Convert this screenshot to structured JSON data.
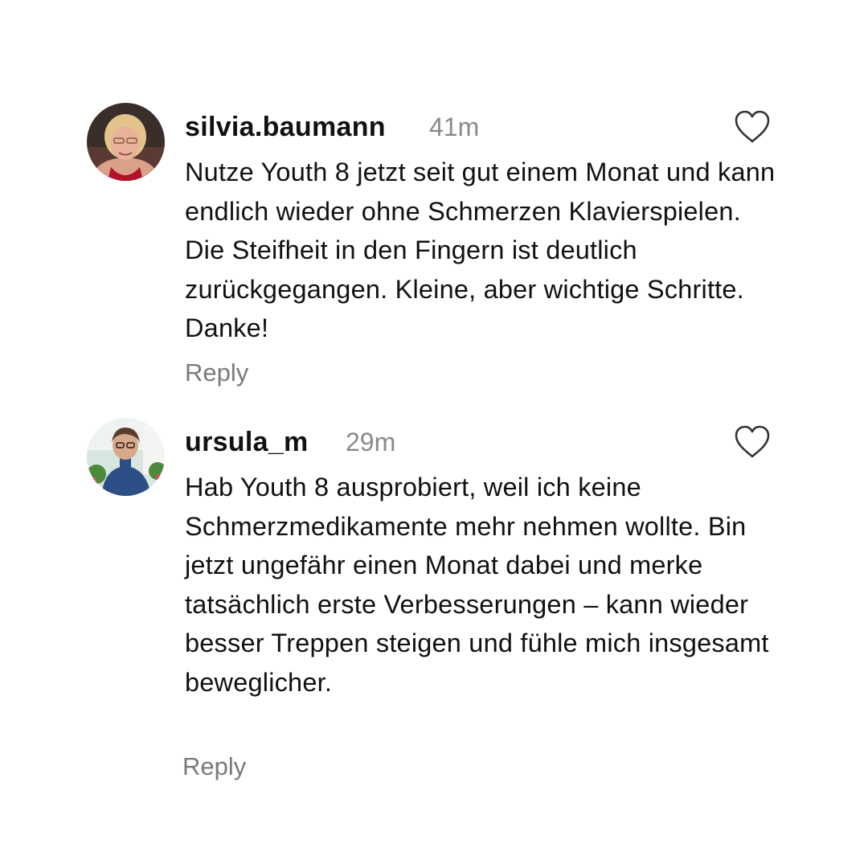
{
  "comments": [
    {
      "username": "silvia.baumann",
      "time": "41m",
      "text": "Nutze Youth 8 jetzt seit gut einem Monat und kann endlich wieder ohne Schmerzen Klavierspielen. Die Steifheit in den Fingern ist deutlich zurückgegangen. Kleine, aber wichtige Schritte. Danke!",
      "reply_label": "Reply",
      "like_icon": "heart-outline-icon"
    },
    {
      "username": "ursula_m",
      "time": "29m",
      "text": "Hab Youth 8 ausprobiert, weil ich keine Schmerzmedikamente mehr nehmen wollte. Bin jetzt ungefähr einen Monat dabei und merke tatsächlich erste Verbesserungen – kann wieder besser Treppen steigen und fühle mich insgesamt beweglicher.",
      "reply_label": "Reply",
      "like_icon": "heart-outline-icon"
    }
  ],
  "colors": {
    "text": "#111111",
    "muted": "#8a8a8a",
    "background": "#ffffff"
  }
}
